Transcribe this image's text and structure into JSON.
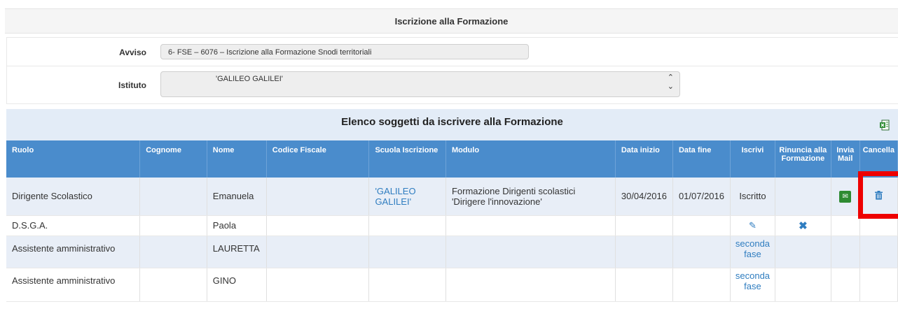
{
  "header": {
    "title": "Iscrizione alla Formazione"
  },
  "form": {
    "avviso_label": "Avviso",
    "avviso_value": "6- FSE – 6076 – Iscrizione alla Formazione Snodi territoriali",
    "istituto_label": "Istituto",
    "istituto_value": "'GALILEO GALILEI'"
  },
  "elenco": {
    "title": "Elenco soggetti da iscrivere alla Formazione"
  },
  "icons": {
    "excel": "excel-export-icon",
    "mail": "envelope-icon",
    "edit": "pencil-icon",
    "remove": "x-icon",
    "delete": "trash-icon"
  },
  "colors": {
    "header_blue": "#4a8ccc",
    "link": "#2f7dc0",
    "mail_green": "#2e8b32",
    "highlight": "#ee0000"
  },
  "table": {
    "columns": {
      "ruolo": "Ruolo",
      "cognome": "Cognome",
      "nome": "Nome",
      "codice_fiscale": "Codice Fiscale",
      "scuola": "Scuola Iscrizione",
      "modulo": "Modulo",
      "data_inizio": "Data inizio",
      "data_fine": "Data fine",
      "iscrivi": "Iscrivi",
      "rinuncia": "Rinuncia alla Formazione",
      "invia_mail": "Invia Mail",
      "cancella": "Cancella"
    },
    "rows": [
      {
        "ruolo": "Dirigente Scolastico",
        "cognome": "",
        "nome": "Emanuela",
        "codice_fiscale": "",
        "scuola": "'GALILEO GALILEI'",
        "modulo": "Formazione Dirigenti scolastici 'Dirigere l'innovazione'",
        "data_inizio": "30/04/2016",
        "data_fine": "01/07/2016",
        "iscrivi": "Iscritto"
      },
      {
        "ruolo": "D.S.G.A.",
        "cognome": "",
        "nome": "Paola"
      },
      {
        "ruolo": "Assistente amministrativo",
        "cognome": "",
        "nome": "LAURETTA",
        "iscrivi": "seconda fase"
      },
      {
        "ruolo": "Assistente amministrativo",
        "cognome": "",
        "nome": "GINO",
        "iscrivi": "seconda fase"
      }
    ]
  }
}
